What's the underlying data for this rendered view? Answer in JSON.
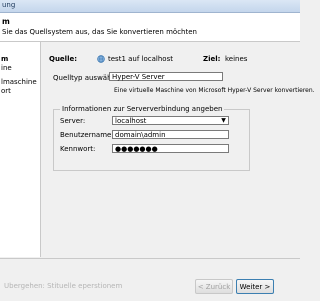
{
  "window": {
    "title": "ung"
  },
  "header": {
    "title": "m",
    "subtitle": "Sie das Quellsystem aus, das Sie konvertieren möchten"
  },
  "sidebar": {
    "items": [
      {
        "label": "m",
        "active": true
      },
      {
        "label": "ine",
        "active": false
      },
      {
        "label": "lmaschine",
        "active": false
      },
      {
        "label": "ort",
        "active": false
      }
    ]
  },
  "main": {
    "quelle_label": "Quelle:",
    "quelle_value": "test1 auf localhost",
    "ziel_label": "Ziel:",
    "ziel_value": "keines",
    "quelltyp_label": "Quelltyp auswählen:",
    "quelltyp_value": "Hyper-V Server",
    "quelltyp_desc": "Eine virtuelle Maschine von Microsoft Hyper-V Server konvertieren.",
    "group_title": "Informationen zur Serververbindung angeben",
    "server_label": "Server:",
    "server_value": "localhost",
    "user_label": "Benutzername:",
    "user_value": "domain\\admin",
    "password_label": "Kennwort:",
    "password_value": "●●●●●●●"
  },
  "footer": {
    "disabled_text": "Ubergehen: Stituelle eperstionem",
    "back_label": "< Zurück",
    "next_label": "Weiter >"
  },
  "icons": {
    "globe": "globe-icon",
    "dropdown": "chevron-down-icon"
  }
}
